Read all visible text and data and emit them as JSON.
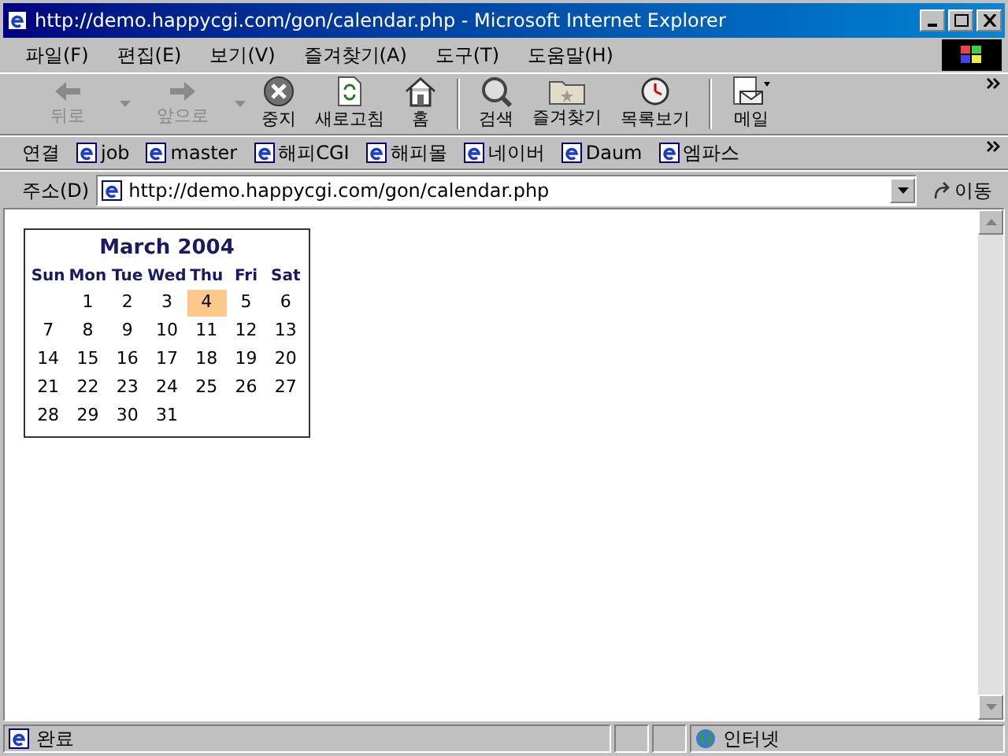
{
  "window": {
    "title": "http://demo.happycgi.com/gon/calendar.php - Microsoft Internet Explorer"
  },
  "menu": [
    "파일(F)",
    "편집(E)",
    "보기(V)",
    "즐겨찾기(A)",
    "도구(T)",
    "도움말(H)"
  ],
  "toolbar": [
    {
      "label": "뒤로",
      "kind": "back",
      "disabled": true
    },
    {
      "label": "앞으로",
      "kind": "forward",
      "disabled": true
    },
    {
      "label": "중지",
      "kind": "stop",
      "disabled": false
    },
    {
      "label": "새로고침",
      "kind": "refresh",
      "disabled": false
    },
    {
      "label": "홈",
      "kind": "home",
      "disabled": false
    },
    {
      "label": "검색",
      "kind": "search",
      "disabled": false
    },
    {
      "label": "즐겨찾기",
      "kind": "favorites",
      "disabled": false
    },
    {
      "label": "목록보기",
      "kind": "history",
      "disabled": false
    },
    {
      "label": "메일",
      "kind": "mail",
      "disabled": false
    }
  ],
  "links": {
    "label": "연결",
    "items": [
      "job",
      "master",
      "해피CGI",
      "해피몰",
      "네이버",
      "Daum",
      "엠파스"
    ]
  },
  "address": {
    "label": "주소(D)",
    "value": "http://demo.happycgi.com/gon/calendar.php",
    "go": "이동"
  },
  "calendar": {
    "title": "March 2004",
    "weekdays": [
      "Sun",
      "Mon",
      "Tue",
      "Wed",
      "Thu",
      "Fri",
      "Sat"
    ],
    "weeks": [
      [
        {
          "day": "1",
          "selected": false
        },
        {
          "day": "2",
          "selected": false
        },
        {
          "day": "3",
          "selected": false
        },
        {
          "day": "4",
          "selected": true
        },
        {
          "day": "5",
          "selected": false
        },
        {
          "day": "6",
          "selected": false
        }
      ],
      [
        {
          "day": "7",
          "selected": false
        },
        {
          "day": "8",
          "selected": false
        },
        {
          "day": "9",
          "selected": false
        },
        {
          "day": "10",
          "selected": false
        },
        {
          "day": "11",
          "selected": false
        },
        {
          "day": "12",
          "selected": false
        },
        {
          "day": "13",
          "selected": false
        }
      ],
      [
        {
          "day": "14",
          "selected": false
        },
        {
          "day": "15",
          "selected": false
        },
        {
          "day": "16",
          "selected": false
        },
        {
          "day": "17",
          "selected": false
        },
        {
          "day": "18",
          "selected": false
        },
        {
          "day": "19",
          "selected": false
        },
        {
          "day": "20",
          "selected": false
        }
      ],
      [
        {
          "day": "21",
          "selected": false
        },
        {
          "day": "22",
          "selected": false
        },
        {
          "day": "23",
          "selected": false
        },
        {
          "day": "24",
          "selected": false
        },
        {
          "day": "25",
          "selected": false
        },
        {
          "day": "26",
          "selected": false
        },
        {
          "day": "27",
          "selected": false
        }
      ],
      [
        {
          "day": "28",
          "selected": false
        },
        {
          "day": "29",
          "selected": false
        },
        {
          "day": "30",
          "selected": false
        },
        {
          "day": "31",
          "selected": false
        }
      ]
    ]
  },
  "status_bar": {
    "text": "완료",
    "zone": "인터넷"
  }
}
